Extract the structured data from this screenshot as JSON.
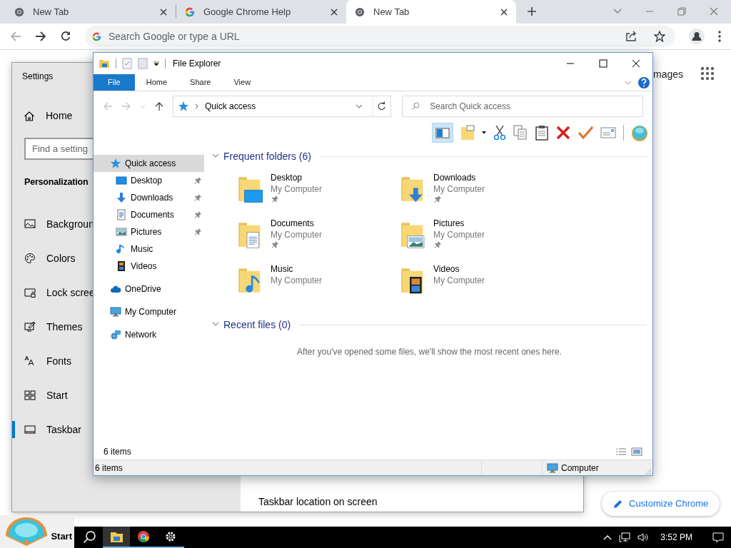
{
  "browser": {
    "tabs": [
      {
        "title": "New Tab",
        "selected": false
      },
      {
        "title": "Google Chrome Help",
        "selected": false
      },
      {
        "title": "New Tab",
        "selected": true
      }
    ],
    "address_placeholder": "Search Google or type a URL",
    "page_link": "mages",
    "customize_button": "Customize Chrome"
  },
  "settings": {
    "title": "Settings",
    "home": "Home",
    "search_placeholder": "Find a setting",
    "section": "Personalization",
    "items": [
      {
        "label": "Backgroun",
        "kind": "background",
        "selected": false
      },
      {
        "label": "Colors",
        "kind": "colors",
        "selected": false
      },
      {
        "label": "Lock scree",
        "kind": "lock",
        "selected": false
      },
      {
        "label": "Themes",
        "kind": "themes",
        "selected": false
      },
      {
        "label": "Fonts",
        "kind": "fonts",
        "selected": false
      },
      {
        "label": "Start",
        "kind": "start",
        "selected": false
      },
      {
        "label": "Taskbar",
        "kind": "taskbar",
        "selected": true
      }
    ],
    "taskbar_location_label": "Taskbar location on screen"
  },
  "explorer": {
    "title": "File Explorer",
    "ribbon_tabs": [
      {
        "label": "File",
        "selected": true
      },
      {
        "label": "Home",
        "selected": false
      },
      {
        "label": "Share",
        "selected": false
      },
      {
        "label": "View",
        "selected": false
      }
    ],
    "address": "Quick access",
    "search_placeholder": "Search Quick access",
    "nav": [
      {
        "label": "Quick access",
        "kind": "star",
        "selected": true,
        "children": [
          {
            "label": "Desktop",
            "kind": "desktop",
            "pinned": true,
            "selected": false
          },
          {
            "label": "Downloads",
            "kind": "downloads",
            "pinned": true,
            "selected": false
          },
          {
            "label": "Documents",
            "kind": "documents",
            "pinned": true,
            "selected": false
          },
          {
            "label": "Pictures",
            "kind": "pictures",
            "pinned": true,
            "selected": false
          },
          {
            "label": "Music",
            "kind": "music",
            "pinned": false,
            "selected": false
          },
          {
            "label": "Videos",
            "kind": "videos",
            "pinned": false,
            "selected": false
          }
        ]
      },
      {
        "label": "OneDrive",
        "kind": "cloud",
        "selected": false
      },
      {
        "label": "My Computer",
        "kind": "computer",
        "selected": false
      },
      {
        "label": "Network",
        "kind": "network",
        "selected": false
      }
    ],
    "frequent_header": "Frequent folders (6)",
    "folders": [
      {
        "name": "Desktop",
        "location": "My Computer",
        "kind": "desktop",
        "pinned": true
      },
      {
        "name": "Downloads",
        "location": "My Computer",
        "kind": "downloads",
        "pinned": true
      },
      {
        "name": "Documents",
        "location": "My Computer",
        "kind": "documents",
        "pinned": true
      },
      {
        "name": "Pictures",
        "location": "My Computer",
        "kind": "pictures",
        "pinned": true
      },
      {
        "name": "Music",
        "location": "My Computer",
        "kind": "music",
        "pinned": false
      },
      {
        "name": "Videos",
        "location": "My Computer",
        "kind": "videos",
        "pinned": false
      }
    ],
    "recent_header": "Recent files (0)",
    "recent_empty": "After you've opened some files, we'll show the most recent ones here.",
    "item_count": "6 items",
    "status_count": "6 items",
    "status_location": "Computer"
  },
  "taskbar": {
    "start": "Start",
    "time": "3:52 PM"
  }
}
